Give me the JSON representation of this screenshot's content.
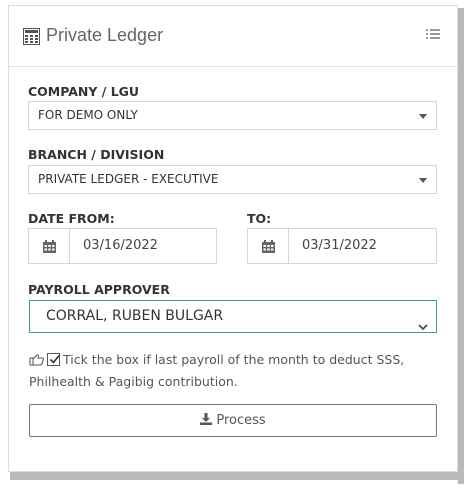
{
  "panel": {
    "title": "Private Ledger",
    "title_icon": "calculator-icon",
    "menu_icon": "list-icon"
  },
  "company": {
    "label": "COMPANY / LGU",
    "value": "FOR DEMO ONLY"
  },
  "branch": {
    "label": "BRANCH / DIVISION",
    "value": "PRIVATE LEDGER - EXECUTIVE"
  },
  "date_from": {
    "label": "DATE FROM:",
    "value": "03/16/2022",
    "icon": "calendar-icon"
  },
  "date_to": {
    "label": "TO:",
    "value": "03/31/2022",
    "icon": "calendar-icon"
  },
  "approver": {
    "label": "PAYROLL APPROVER",
    "value": "CORRAL, RUBEN BULGAR"
  },
  "note": {
    "text": "Tick the box if last payroll of the month to deduct SSS, Philhealth & Pagibig contribution.",
    "checked": true
  },
  "actions": {
    "process_label": "Process",
    "process_icon": "download-icon"
  },
  "colors": {
    "approver_border": "#3aa57a",
    "shadow": "#b9b9b9"
  }
}
